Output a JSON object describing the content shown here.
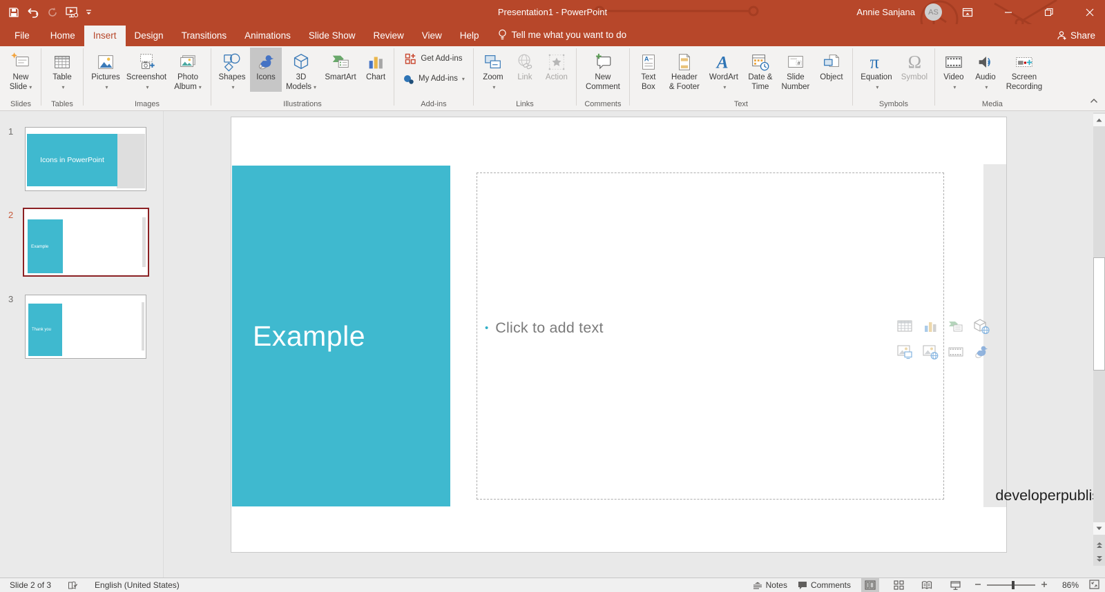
{
  "colors": {
    "brand_red": "#B7472A",
    "teal_accent": "#3FB9CF",
    "selected_slide_border": "#8B2023",
    "ribbon_bg": "#F3F2F1",
    "active_button_bg": "#C6C6C6"
  },
  "title_bar": {
    "title": "Presentation1 - PowerPoint",
    "user_name": "Annie Sanjana",
    "avatar_initials": "AS"
  },
  "tabs": {
    "items": [
      "File",
      "Home",
      "Insert",
      "Design",
      "Transitions",
      "Animations",
      "Slide Show",
      "Review",
      "View",
      "Help"
    ],
    "active_tab": "Insert",
    "tell_me": "Tell me what you want to do",
    "share_label": "Share"
  },
  "ribbon": {
    "group_labels": {
      "slides": "Slides",
      "tables": "Tables",
      "images": "Images",
      "illustrations": "Illustrations",
      "add_ins": "Add-ins",
      "links": "Links",
      "comments": "Comments",
      "text": "Text",
      "symbols": "Symbols",
      "media": "Media"
    },
    "buttons": {
      "new_slide": {
        "l1": "New",
        "l2": "Slide"
      },
      "table": {
        "l1": "Table"
      },
      "pictures": {
        "l1": "Pictures"
      },
      "screenshot": {
        "l1": "Screenshot"
      },
      "photo_album": {
        "l1": "Photo",
        "l2": "Album"
      },
      "shapes": {
        "l1": "Shapes"
      },
      "icons": {
        "l1": "Icons"
      },
      "models_3d": {
        "l1": "3D",
        "l2": "Models"
      },
      "smartart": {
        "l1": "SmartArt"
      },
      "chart": {
        "l1": "Chart"
      },
      "get_add_ins": {
        "l1": "Get Add-ins"
      },
      "my_add_ins": {
        "l1": "My Add-ins"
      },
      "zoom": {
        "l1": "Zoom"
      },
      "link": {
        "l1": "Link"
      },
      "action": {
        "l1": "Action"
      },
      "new_comment": {
        "l1": "New",
        "l2": "Comment"
      },
      "text_box": {
        "l1": "Text",
        "l2": "Box"
      },
      "header_footer": {
        "l1": "Header",
        "l2": "& Footer"
      },
      "wordart": {
        "l1": "WordArt"
      },
      "date_time": {
        "l1": "Date &",
        "l2": "Time"
      },
      "slide_number": {
        "l1": "Slide",
        "l2": "Number"
      },
      "object": {
        "l1": "Object"
      },
      "equation": {
        "l1": "Equation"
      },
      "symbol": {
        "l1": "Symbol"
      },
      "video": {
        "l1": "Video"
      },
      "audio": {
        "l1": "Audio"
      },
      "screen_recording": {
        "l1": "Screen",
        "l2": "Recording"
      }
    }
  },
  "slides_panel": {
    "slides": [
      {
        "number": "1",
        "title": "Icons in PowerPoint"
      },
      {
        "number": "2",
        "title": "Example"
      },
      {
        "number": "3",
        "title": "Thank you"
      }
    ],
    "selected_slide": 2
  },
  "slide_canvas": {
    "title": "Example",
    "body_placeholder": "Click to add text",
    "footer_text": "developerpublish.com"
  },
  "status_bar": {
    "slide_indicator": "Slide 2 of 3",
    "language": "English (United States)",
    "notes_label": "Notes",
    "comments_label": "Comments",
    "zoom_percent": "86%"
  }
}
